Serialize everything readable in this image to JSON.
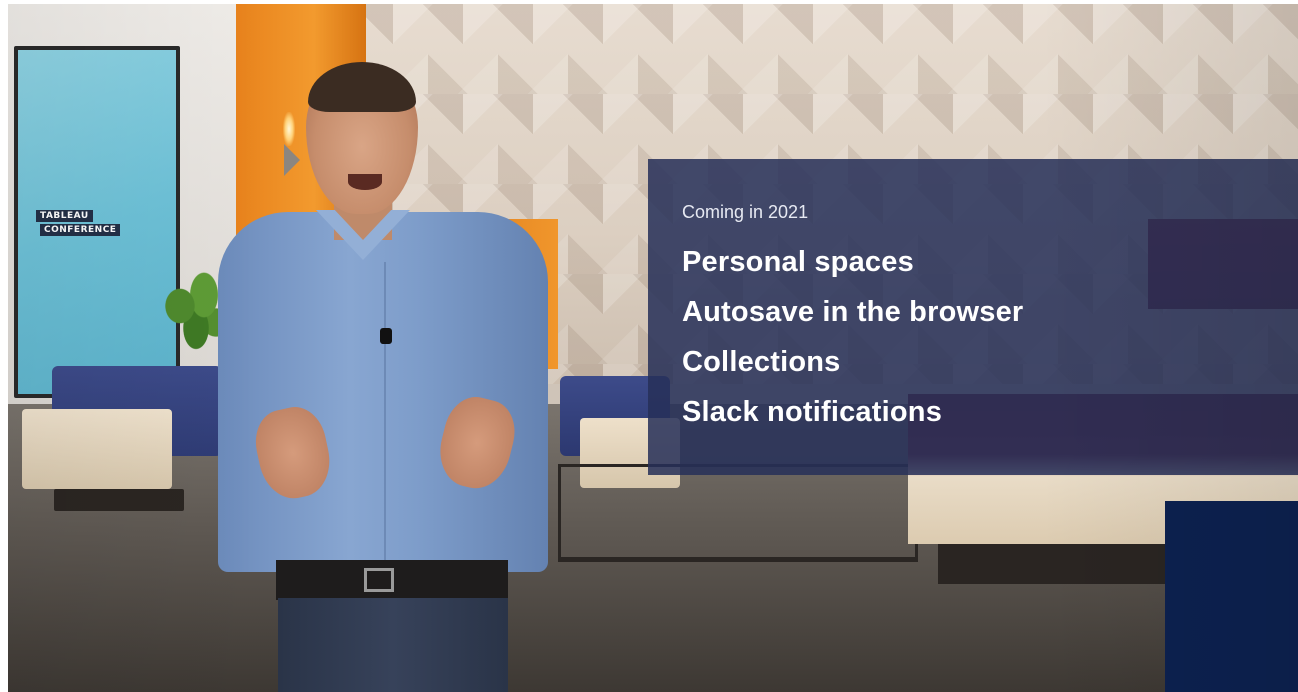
{
  "video": {
    "set_screen": {
      "logo_line1": "TABLEAU",
      "logo_line2": "CONFERENCE"
    },
    "overlay": {
      "kicker": "Coming in 2021",
      "features": [
        "Personal spaces",
        "Autosave in the browser",
        "Collections",
        "Slack notifications"
      ]
    },
    "colors": {
      "overlay_bg": "#263058",
      "corner_block": "#0d2150",
      "accent_orange": "#f0962c"
    }
  }
}
